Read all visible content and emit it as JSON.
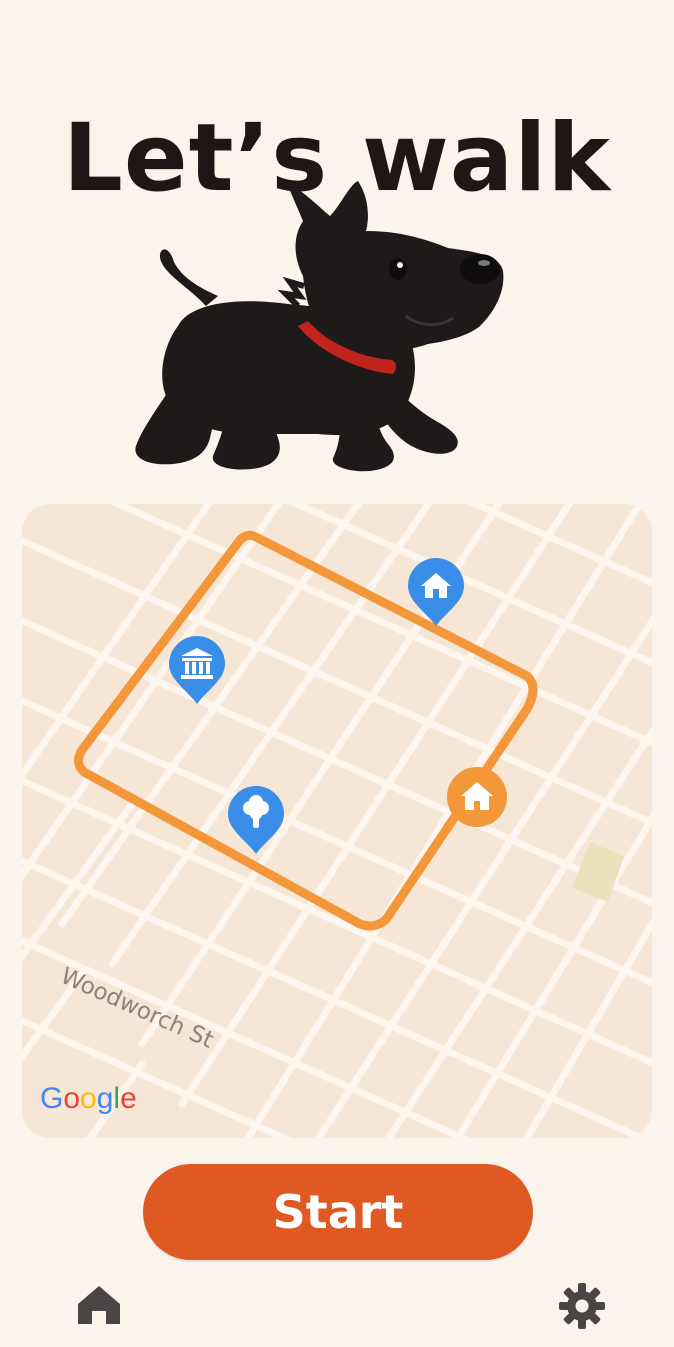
{
  "header": {
    "title": "Let’s walk"
  },
  "map": {
    "street_label": "Woodworch St",
    "attribution": [
      "G",
      "o",
      "o",
      "g",
      "l",
      "e"
    ],
    "attribution_colors": [
      "#4285F4",
      "#EA4335",
      "#FBBC05",
      "#4285F4",
      "#34A853",
      "#EA4335"
    ],
    "route_color": "#f4963a",
    "pins": [
      {
        "name": "home-pin",
        "icon": "house-icon"
      },
      {
        "name": "museum-pin",
        "icon": "bank-icon"
      },
      {
        "name": "park-pin",
        "icon": "tree-icon"
      },
      {
        "name": "start-home-marker",
        "icon": "house-icon"
      }
    ]
  },
  "actions": {
    "start_label": "Start"
  },
  "nav": {
    "home": "home-icon",
    "settings": "gear-icon"
  },
  "colors": {
    "accent": "#de5a22",
    "background": "#fbf4ed",
    "pin": "#3a8ee8"
  }
}
